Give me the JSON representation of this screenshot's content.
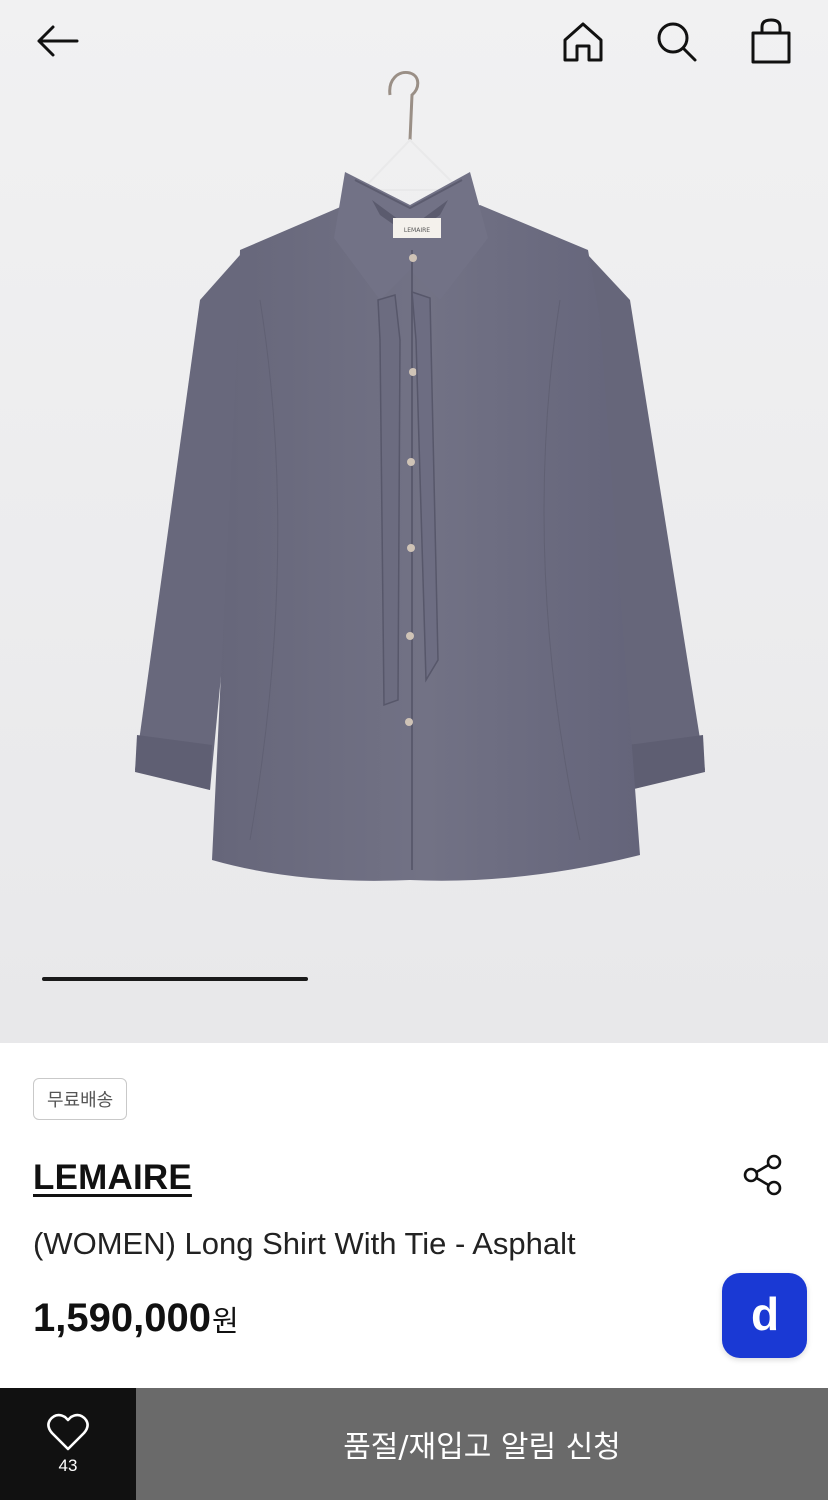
{
  "header": {
    "back_icon": "arrow-left-icon",
    "home_icon": "home-icon",
    "search_icon": "search-icon",
    "bag_icon": "shopping-bag-icon"
  },
  "gallery": {
    "image": "gray long shirt with tie on hanger",
    "shirt_color": "#6e6e7f",
    "background_color": "#ededee",
    "label_text": "LEMAIRE",
    "progress": 0.357
  },
  "product": {
    "badge": "무료배송",
    "brand": "LEMAIRE",
    "name": "(WOMEN) Long Shirt With Tie - Asphalt",
    "price": "1,590,000",
    "price_unit": "원",
    "share_icon": "share-icon"
  },
  "floating": {
    "icon": "d-logo-icon",
    "letter": "d",
    "color": "#1a39d4"
  },
  "bottom_bar": {
    "like_icon": "heart-icon",
    "like_count": "43",
    "notify_label": "품절/재입고 알림 신청"
  }
}
